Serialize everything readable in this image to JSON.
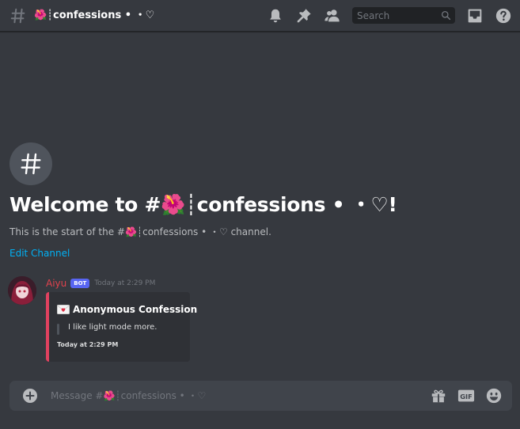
{
  "header": {
    "channel_title": "🌺┊confessions • ・♡",
    "search_placeholder": "Search"
  },
  "welcome": {
    "title": "Welcome to #🌺┊confessions • ・♡!",
    "subtitle": "This is the start of the #🌺┊confessions • ・♡ channel.",
    "edit_label": "Edit Channel"
  },
  "message": {
    "author": "Aiyu",
    "bot_tag": "BOT",
    "timestamp": "Today at 2:29 PM",
    "embed": {
      "title": "Anonymous Confession",
      "description": "I like light mode more.",
      "footer": "Today at 2:29 PM",
      "accent_color": "#e0415f"
    }
  },
  "composer": {
    "placeholder": "Message #🌺┊confessions • ・♡",
    "gif_label": "GIF"
  },
  "colors": {
    "background": "#36393f",
    "link": "#00b0f4",
    "author": "#e0424d",
    "bot_tag": "#5865f2"
  }
}
